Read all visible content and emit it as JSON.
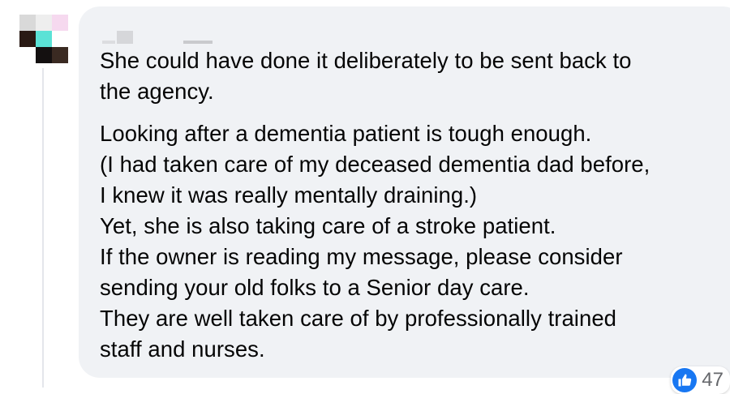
{
  "comment": {
    "paragraphs": [
      "She could have done it deliberately to be sent back to\nthe agency.",
      "Looking after a dementia patient is tough enough.\n(I had taken care of my deceased dementia dad before,\nI knew it was really mentally draining.)\nYet, she is also taking care of a stroke patient.\nIf the owner is reading my message, please consider\nsending your old folks to a Senior day care.\nThey are well taken care of by professionally trained\nstaff and nurses."
    ]
  },
  "reactions": {
    "icon": "thumbs-up-icon",
    "count": "47",
    "color": "#1877f2"
  },
  "colors": {
    "bubble": "#f0f2f5",
    "text": "#050505",
    "meta": "#65676b"
  }
}
